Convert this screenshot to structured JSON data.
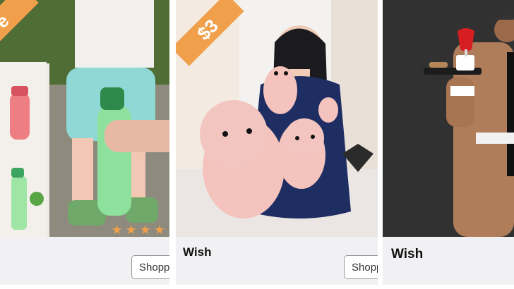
{
  "cards": [
    {
      "price": "e",
      "store": "",
      "button": "Shopp",
      "rating_stars": "★★★★"
    },
    {
      "price": "$3",
      "store": "Wish",
      "button": "Shopp"
    },
    {
      "store": "Wish"
    }
  ],
  "colors": {
    "accent": "#f0a04b",
    "footer": "#f1f1f3"
  }
}
